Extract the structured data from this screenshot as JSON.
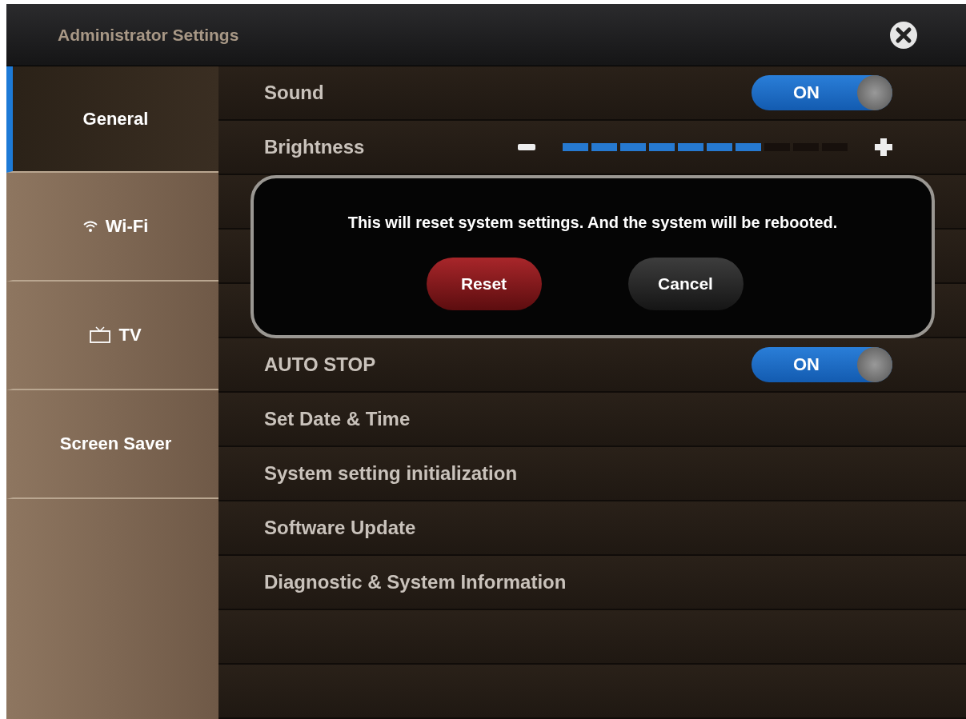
{
  "window": {
    "title": "Administrator Settings"
  },
  "sidebar": {
    "items": [
      {
        "label": "General",
        "kind": "text",
        "selected": true
      },
      {
        "label": "Wi-Fi",
        "kind": "wifi",
        "selected": false
      },
      {
        "label": "TV",
        "kind": "tv",
        "selected": false
      },
      {
        "label": "Screen Saver",
        "kind": "text",
        "selected": false
      }
    ]
  },
  "settings": [
    {
      "kind": "toggle",
      "label": "Sound",
      "on": true,
      "state_text": "ON"
    },
    {
      "kind": "slider",
      "label": "Brightness",
      "level": 0.7
    },
    {
      "kind": "toggle",
      "label": "AUTO STOP",
      "on": true,
      "state_text": "ON"
    },
    {
      "kind": "link",
      "label": "Set Date & Time"
    },
    {
      "kind": "link",
      "label": "System setting initialization"
    },
    {
      "kind": "link",
      "label": "Software Update"
    },
    {
      "kind": "link",
      "label": "Diagnostic & System Information"
    }
  ],
  "dialog": {
    "message": "This will reset system settings. And the system will be rebooted.",
    "buttons": [
      {
        "label": "Reset",
        "kind": "danger"
      },
      {
        "label": "Cancel",
        "kind": "plain"
      }
    ]
  }
}
